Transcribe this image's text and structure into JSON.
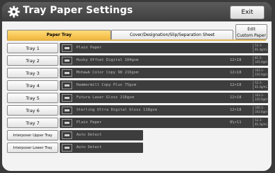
{
  "header": {
    "title": "Tray Paper Settings",
    "exit_label": "Exit"
  },
  "tabs": [
    {
      "label": "Paper Tray",
      "active": true
    },
    {
      "label": "Cover/Designation/Slip/Separation Sheet",
      "active": false
    }
  ],
  "edit_custom_paper": {
    "line1": "Edit",
    "line2": "Custom Paper"
  },
  "rows": [
    {
      "button": "Tray 1",
      "paper": "Plain Paper",
      "size": "",
      "weight_top": "52.3–",
      "weight_bottom": "81.4g/m2"
    },
    {
      "button": "Tray 2",
      "paper": "Husky Offset Digital 104gsm",
      "size": "12×18",
      "weight_top": "81.5–",
      "weight_bottom": "105.0g/m2"
    },
    {
      "button": "Tray 3",
      "paper": "Mohawk Color Copy 98 216gsm",
      "size": "12×18",
      "weight_top": "163.1–",
      "weight_bottom": "220.0g/m2"
    },
    {
      "button": "Tray 4",
      "paper": "Hammermill Copy Plus 75gsm",
      "size": "12×18",
      "weight_top": "52.3–",
      "weight_bottom": "81.4g/m2"
    },
    {
      "button": "Tray 5",
      "paper": "Futura Laser Gloss 216gsm",
      "size": "12×18",
      "weight_top": "163.1–",
      "weight_bottom": "220.0g/m2"
    },
    {
      "button": "Tray 6",
      "paper": "Sterling Ultra Digital Gloss 118gsm",
      "size": "12×18",
      "weight_top": "105.1–",
      "weight_bottom": "163.0g/m2"
    },
    {
      "button": "Tray 7",
      "paper": "Plain Paper",
      "size": "8½×11",
      "weight_top": "52.3–",
      "weight_bottom": "81.4g/m2"
    },
    {
      "button": "Interposer Upper Tray",
      "paper": "Auto Detect",
      "size": "",
      "weight_top": "",
      "weight_bottom": ""
    },
    {
      "button": "Interposer Lower Tray",
      "paper": "Auto Detect",
      "size": "",
      "weight_top": "",
      "weight_bottom": ""
    }
  ],
  "colors": {
    "title_bar": "#4a4a4a",
    "active_tab": "#f5c24a",
    "info_bar": "#3d3d3d"
  }
}
